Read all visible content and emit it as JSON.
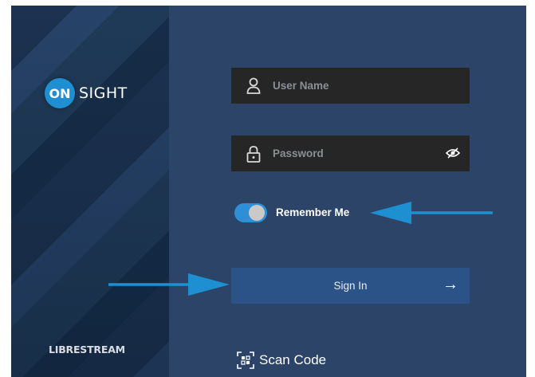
{
  "logo": {
    "badge": "ON",
    "word": "SIGHT"
  },
  "brand": "LIBRESTREAM",
  "username": {
    "placeholder": "User Name",
    "icon": "user-icon"
  },
  "password": {
    "placeholder": "Password",
    "icon": "lock-icon",
    "toggle_icon": "eye-slash-icon"
  },
  "remember": {
    "label": "Remember Me",
    "checked": true
  },
  "signin": {
    "label": "Sign In",
    "icon": "arrow-right-icon"
  },
  "scan": {
    "label": "Scan Code",
    "icon": "qr-scan-icon"
  },
  "colors": {
    "accent": "#2e8fd6",
    "annotation_arrow": "#1e8fd0",
    "background": "#2b4468",
    "field": "#262626",
    "button": "#2c5388"
  }
}
